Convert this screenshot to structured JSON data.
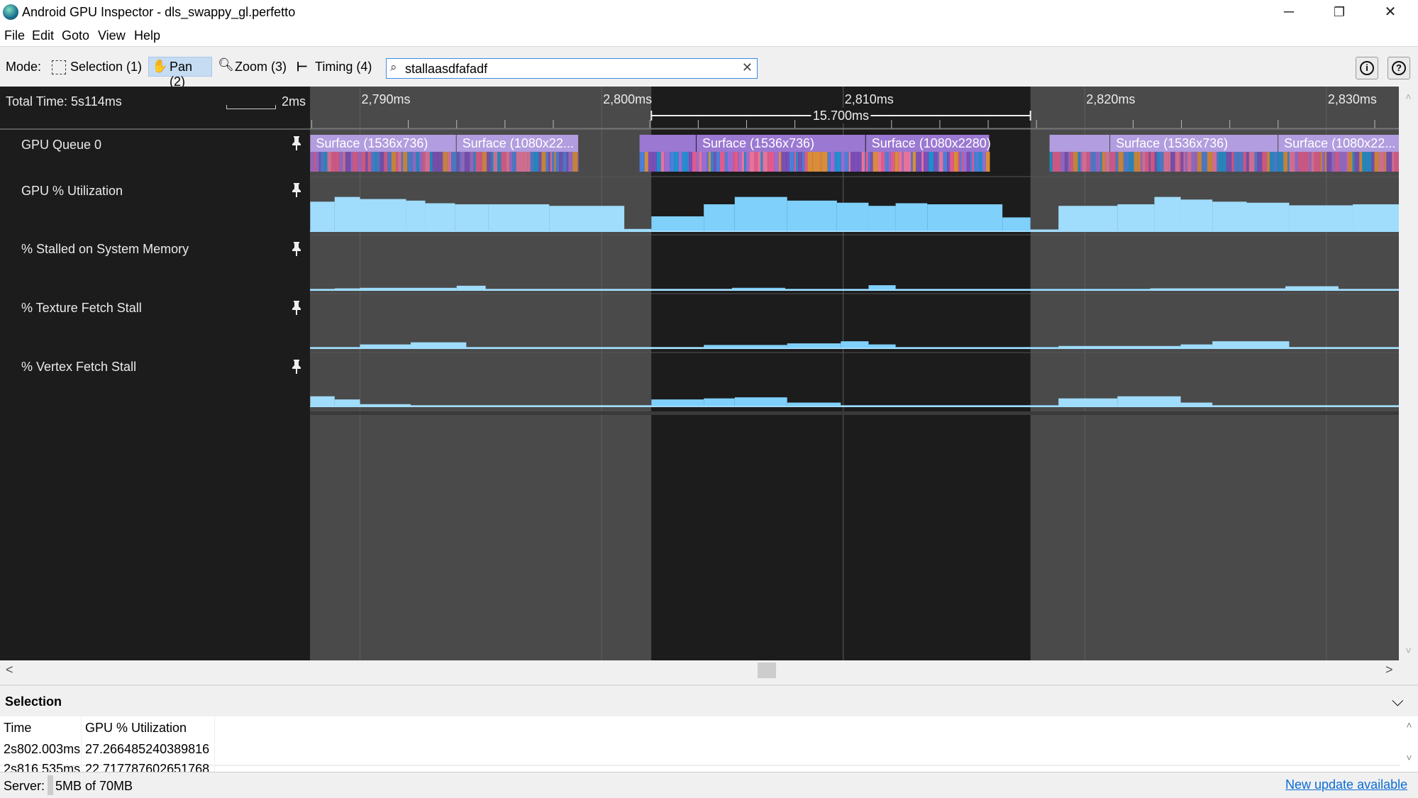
{
  "window": {
    "title": "Android GPU Inspector - dls_swappy_gl.perfetto",
    "controls": [
      "minimize-icon",
      "restore-icon",
      "close-icon"
    ]
  },
  "menu": [
    "File",
    "Edit",
    "Goto",
    "View",
    "Help"
  ],
  "toolbar": {
    "mode_label": "Mode:",
    "modes": [
      {
        "label": "Selection (1)",
        "icon": "selection-icon",
        "active": false
      },
      {
        "label": "Pan (2)",
        "icon": "hand-icon",
        "active": true
      },
      {
        "label": "Zoom (3)",
        "icon": "zoom-icon",
        "active": false
      },
      {
        "label": "Timing (4)",
        "icon": "timing-icon",
        "active": false
      }
    ],
    "search_value": "stallaasdfafadf",
    "info_icon": "info-icon",
    "help_icon": "help-icon"
  },
  "timeline": {
    "total_time": "Total Time: 5s114ms",
    "scale_label": "2ms",
    "ruler_labels": [
      "2,790ms",
      "2,800ms",
      "2,810ms",
      "2,820ms",
      "2,830ms"
    ],
    "ruler_ticks_ms": [
      2790,
      2800,
      2810,
      2820,
      2830
    ],
    "visible_range_ms": [
      2787.94,
      2833.03
    ],
    "selection": {
      "start_ms": 2802.06,
      "end_ms": 2817.75,
      "label": "15.700ms"
    },
    "colors": {
      "band": "#4a4a4a",
      "selected_band": "#1c1c1c",
      "graph": "#a0dcfb",
      "graph_selected": "#7fd0fb",
      "slice": "#b19ddf",
      "slice_selected": "#9b78d2"
    },
    "tracks": [
      {
        "label": "GPU Queue 0",
        "type": "slices",
        "slices": [
          {
            "start": 2787.94,
            "end": 2794.0,
            "label": "Surface (1536x736)"
          },
          {
            "start": 2794.0,
            "end": 2799.06,
            "label": "Surface (1080x22..."
          },
          {
            "start": 2801.57,
            "end": 2803.93,
            "label": ""
          },
          {
            "start": 2803.93,
            "end": 2810.94,
            "label": "Surface (1536x736)"
          },
          {
            "start": 2810.94,
            "end": 2816.07,
            "label": "Surface (1080x2280)"
          },
          {
            "start": 2818.54,
            "end": 2821.05,
            "label": ""
          },
          {
            "start": 2821.05,
            "end": 2828.01,
            "label": "Surface (1536x736)"
          },
          {
            "start": 2828.01,
            "end": 2833.03,
            "label": "Surface (1080x22..."
          }
        ]
      },
      {
        "label": "GPU % Utilization",
        "type": "counter",
        "ylim": [
          0,
          100
        ],
        "steps": [
          [
            2787.94,
            55
          ],
          [
            2788.95,
            64
          ],
          [
            2790,
            60
          ],
          [
            2791.91,
            57
          ],
          [
            2792.7,
            52
          ],
          [
            2793.93,
            50
          ],
          [
            2795.32,
            50
          ],
          [
            2797.83,
            47
          ],
          [
            2800.94,
            3
          ],
          [
            2802.06,
            27
          ],
          [
            2804.23,
            50
          ],
          [
            2805.51,
            64
          ],
          [
            2807.68,
            57
          ],
          [
            2809.74,
            53
          ],
          [
            2811.05,
            47
          ],
          [
            2812.17,
            52
          ],
          [
            2813.48,
            50
          ],
          [
            2816.59,
            25
          ],
          [
            2817.75,
            2
          ],
          [
            2818.91,
            47
          ],
          [
            2821.35,
            50
          ],
          [
            2822.88,
            64
          ],
          [
            2823.97,
            59
          ],
          [
            2825.28,
            55
          ],
          [
            2826.7,
            53
          ],
          [
            2828.46,
            48
          ],
          [
            2831.09,
            50
          ]
        ]
      },
      {
        "label": "% Stalled on System Memory",
        "type": "counter",
        "ylim": [
          0,
          100
        ],
        "steps": [
          [
            2787.94,
            1
          ],
          [
            2788.95,
            2
          ],
          [
            2790,
            3
          ],
          [
            2794.0,
            7
          ],
          [
            2795.2,
            1
          ],
          [
            2805.4,
            3
          ],
          [
            2807.6,
            1
          ],
          [
            2811.05,
            8
          ],
          [
            2812.17,
            1
          ],
          [
            2822.7,
            2
          ],
          [
            2828.3,
            6
          ],
          [
            2830.5,
            1
          ]
        ]
      },
      {
        "label": "% Texture Fetch Stall",
        "type": "counter",
        "ylim": [
          0,
          100
        ],
        "steps": [
          [
            2787.94,
            1
          ],
          [
            2790,
            6
          ],
          [
            2792.1,
            10
          ],
          [
            2794.4,
            1
          ],
          [
            2804.23,
            5
          ],
          [
            2807.68,
            8
          ],
          [
            2809.9,
            12
          ],
          [
            2811.05,
            6
          ],
          [
            2812.17,
            1
          ],
          [
            2818.91,
            3
          ],
          [
            2823.97,
            6
          ],
          [
            2825.28,
            12
          ],
          [
            2828.46,
            1
          ]
        ]
      },
      {
        "label": "% Vertex Fetch Stall",
        "type": "counter",
        "ylim": [
          0,
          100
        ],
        "steps": [
          [
            2787.94,
            18
          ],
          [
            2788.95,
            12
          ],
          [
            2790,
            3
          ],
          [
            2792.1,
            1
          ],
          [
            2802.06,
            12
          ],
          [
            2804.23,
            14
          ],
          [
            2805.51,
            16
          ],
          [
            2807.68,
            6
          ],
          [
            2809.9,
            1
          ],
          [
            2818.91,
            14
          ],
          [
            2821.35,
            18
          ],
          [
            2823.97,
            6
          ],
          [
            2825.28,
            1
          ]
        ]
      }
    ]
  },
  "selection_panel": {
    "title": "Selection",
    "columns": [
      "Time",
      "GPU % Utilization"
    ],
    "rows": [
      [
        "2s802.003ms",
        "27.266485240389816"
      ],
      [
        "2s816.535ms",
        "22.717787602651768"
      ]
    ]
  },
  "status": {
    "server_label": "Server:",
    "memory": "5MB of 70MB",
    "update_link": "New update available"
  }
}
